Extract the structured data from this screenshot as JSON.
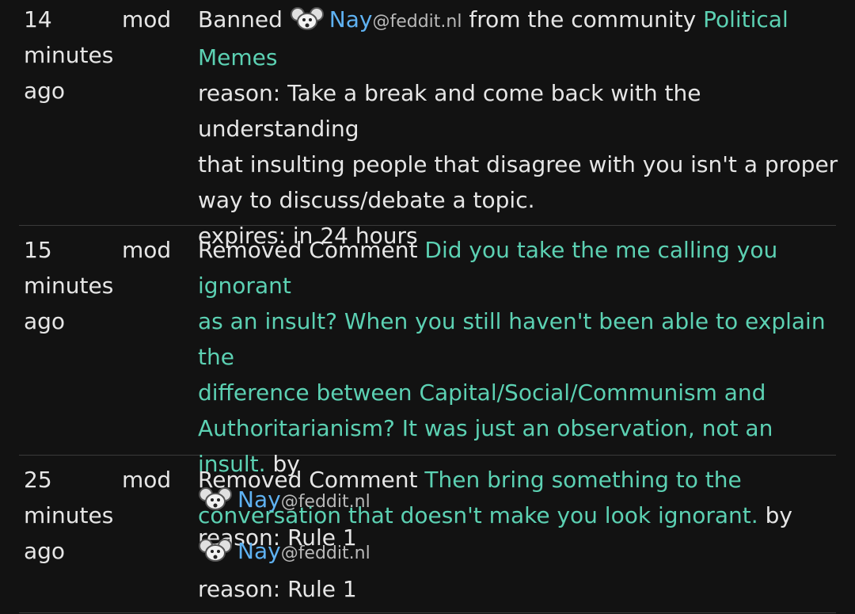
{
  "entries": [
    {
      "time_num": "14",
      "time_unit": "minutes",
      "time_ago": "ago",
      "actor": "mod",
      "action": "Banned",
      "user": "Nay",
      "instance": "@feddit.nl",
      "mid": "from the community",
      "community_a": "Political",
      "community_b": "Memes",
      "reason_1": "reason: Take a break and come back with the understanding",
      "reason_2": "that insulting people that disagree with you isn't a proper",
      "reason_3": "way to discuss/debate a topic.",
      "expires": "expires: in 24 hours"
    },
    {
      "time_num": "15",
      "time_unit": "minutes",
      "time_ago": "ago",
      "actor": "mod",
      "action": "Removed Comment",
      "comment_1": "Did you take the me calling you ignorant",
      "comment_2": "as an insult? When you still haven't been able to explain the",
      "comment_3": "difference between Capital/Social/Communism and",
      "comment_4": "Authoritarianism? It was just an observation, not an insult.",
      "by": "by",
      "user": "Nay",
      "instance": "@feddit.nl",
      "reason": "reason: Rule 1"
    },
    {
      "time_num": "25",
      "time_unit": "minutes",
      "time_ago": "ago",
      "actor": "mod",
      "action": "Removed Comment",
      "comment_1": "Then bring something to the",
      "comment_2": "conversation that doesn't make you look ignorant.",
      "by": "by",
      "user": "Nay",
      "instance": "@feddit.nl",
      "reason": "reason: Rule 1"
    }
  ],
  "colors": {
    "background": "#121212",
    "text": "#e6e6e6",
    "link_teal": "#5cd1b3",
    "link_blue": "#5fb2f2",
    "instance_gray": "#b9b9b9",
    "divider": "#3a3a3a"
  },
  "icons": {
    "avatar": "mouse-avatar-icon"
  }
}
